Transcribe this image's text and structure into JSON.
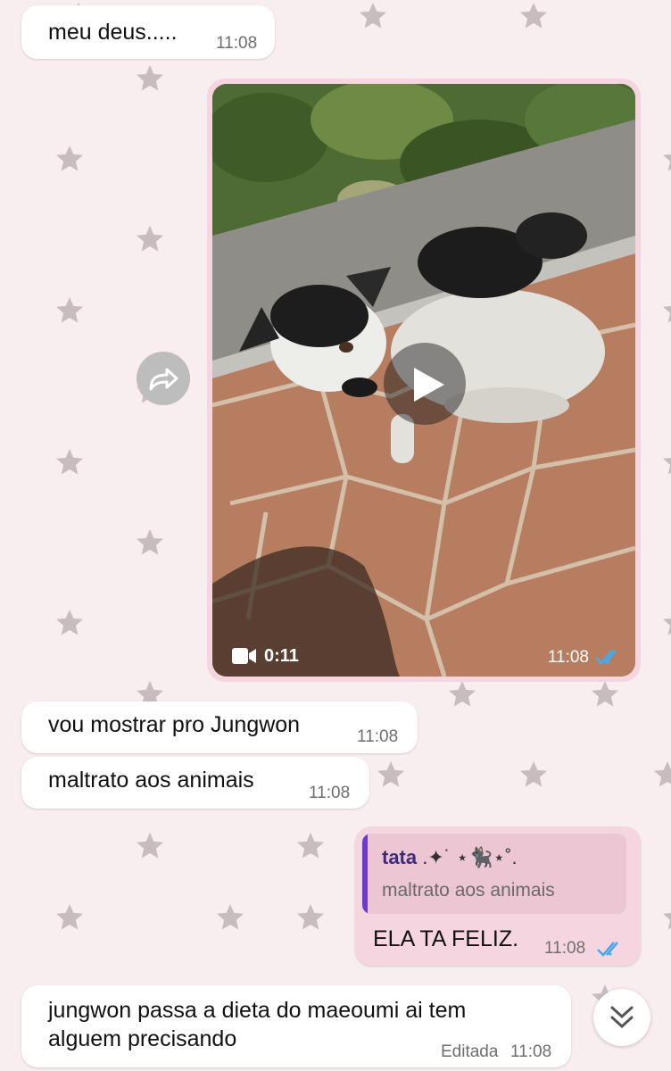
{
  "colors": {
    "background": "#f8edef",
    "incoming_bubble": "#ffffff",
    "outgoing_bubble": "#f5d6e0",
    "read_ticks": "#4aa7e8",
    "quote_bar": "#6a3ad0"
  },
  "messages": [
    {
      "id": "m1",
      "direction": "incoming",
      "text": "meu deus.....",
      "time": "11:08"
    },
    {
      "id": "m2",
      "direction": "outgoing",
      "type": "video",
      "duration": "0:11",
      "time": "11:08",
      "status": "read",
      "icons": [
        "video-camera-icon",
        "play-icon",
        "forward-icon",
        "double-check-icon"
      ]
    },
    {
      "id": "m3",
      "direction": "incoming",
      "text": "vou mostrar pro Jungwon",
      "time": "11:08"
    },
    {
      "id": "m4",
      "direction": "incoming",
      "text": "maltrato aos animais",
      "time": "11:08"
    },
    {
      "id": "m5",
      "direction": "outgoing",
      "text": "ELA TA FELIZ.",
      "time": "11:08",
      "status": "read",
      "quote": {
        "author": "tata",
        "author_decoration": ".✦˙ ⋆🐈‍⬛⋆˚.",
        "text": "maltrato aos animais"
      }
    },
    {
      "id": "m6",
      "direction": "incoming",
      "text_lines": [
        "jungwon passa a dieta do maeoumi ai tem",
        "alguem precisando"
      ],
      "edited_label": "Editada",
      "time": "11:08"
    }
  ],
  "controls": {
    "scroll_down_icon": "double-chevron-down-icon"
  }
}
